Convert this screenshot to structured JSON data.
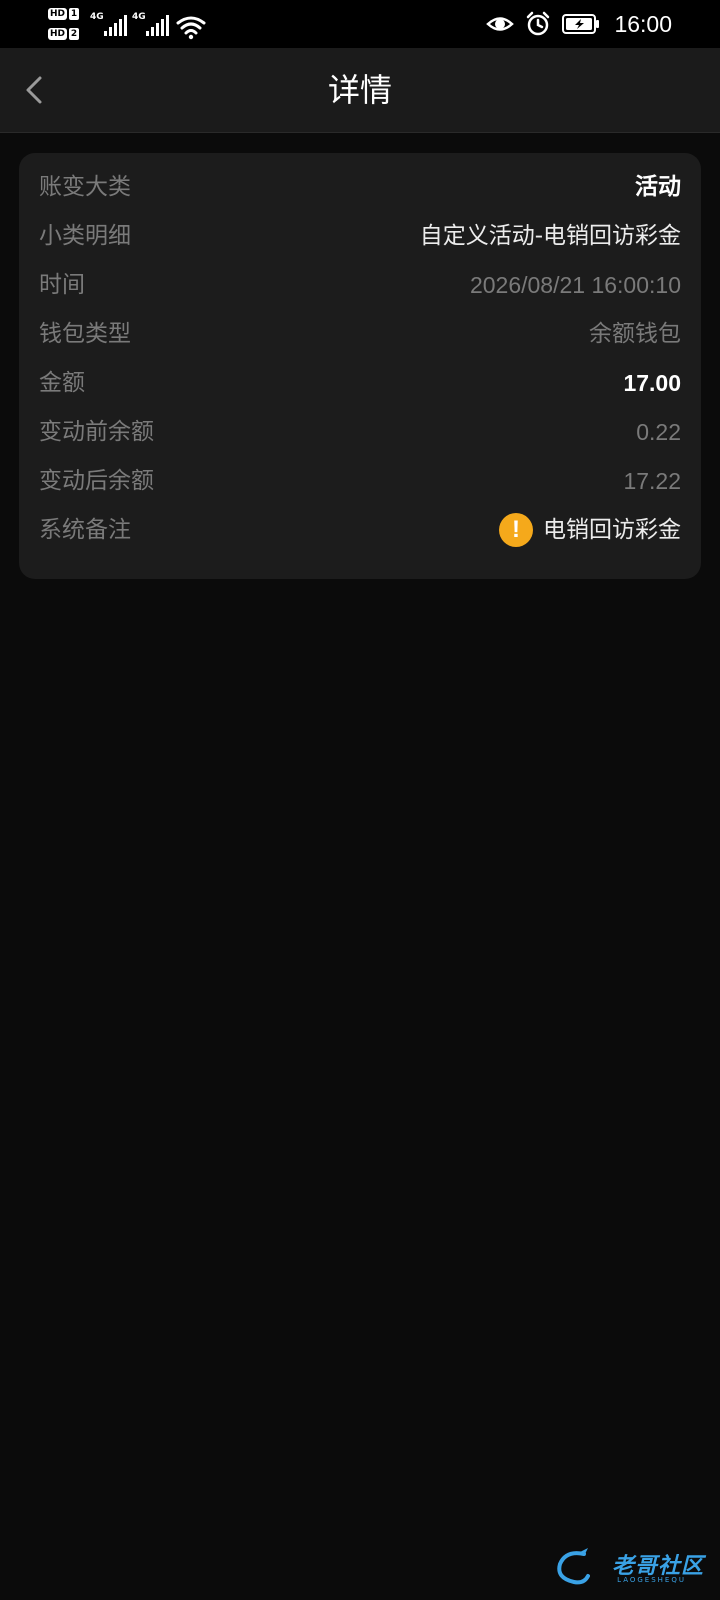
{
  "status_bar": {
    "sim1_hd": "HD",
    "sim1_num": "1",
    "sim2_hd": "HD",
    "sim2_num": "2",
    "net1": "4G",
    "net2": "4G",
    "time": "16:00"
  },
  "header": {
    "title": "详情"
  },
  "details": {
    "rows": [
      {
        "label": "账变大类",
        "value": "活动"
      },
      {
        "label": "小类明细",
        "value": "自定义活动-电销回访彩金"
      },
      {
        "label": "时间",
        "value": "2026/08/21 16:00:10"
      },
      {
        "label": "钱包类型",
        "value": "余额钱包"
      },
      {
        "label": "金额",
        "value": "17.00"
      },
      {
        "label": "变动前余额",
        "value": "0.22"
      },
      {
        "label": "变动后余额",
        "value": "17.22"
      },
      {
        "label": "系统备注",
        "value": "电销回访彩金",
        "icon": "warning-icon",
        "icon_glyph": "!"
      }
    ]
  },
  "watermark": {
    "text": "老哥社区",
    "sub": "LAOGESHEQU"
  },
  "colors": {
    "background": "#0b0b0b",
    "card": "#1c1c1c",
    "header": "#1b1b1b",
    "label": "#7a7a7a",
    "warning": "#f5a91b"
  }
}
